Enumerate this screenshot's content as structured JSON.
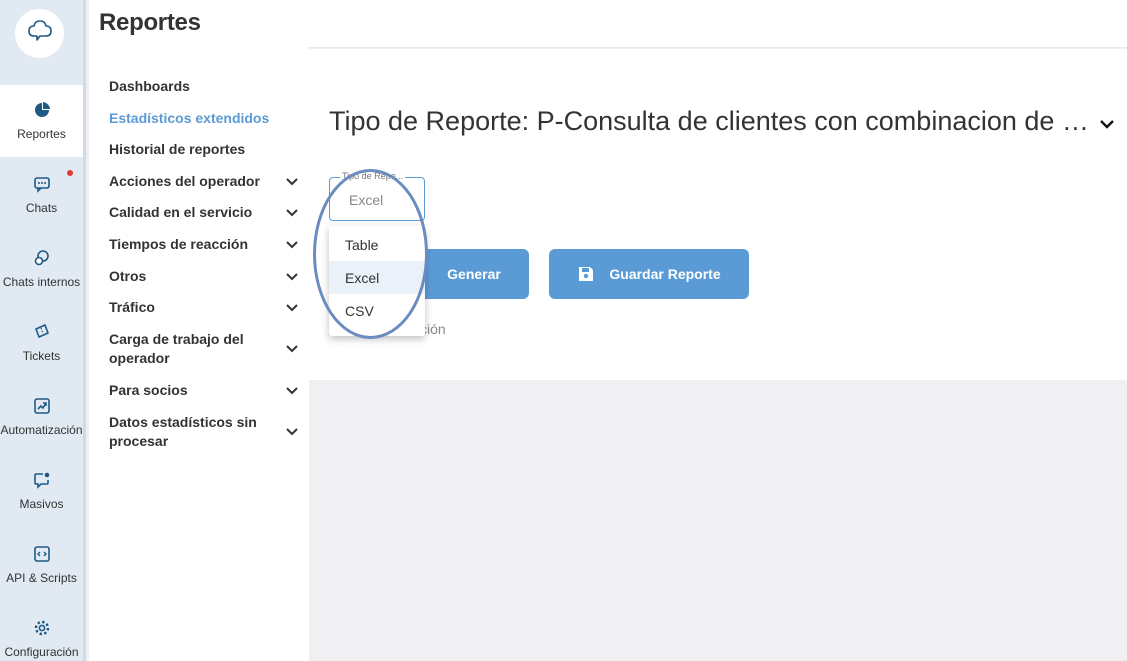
{
  "rail": {
    "items": [
      {
        "label": "Reportes",
        "icon": "pie-chart-icon"
      },
      {
        "label": "Chats",
        "icon": "chat-icon"
      },
      {
        "label": "Chats internos",
        "icon": "internal-chat-icon"
      },
      {
        "label": "Tickets",
        "icon": "ticket-icon"
      },
      {
        "label": "Automatización",
        "icon": "trend-icon"
      },
      {
        "label": "Masivos",
        "icon": "broadcast-icon"
      },
      {
        "label": "API & Scripts",
        "icon": "code-icon"
      },
      {
        "label": "Configuración",
        "icon": "gear-icon"
      }
    ],
    "accent": "#1f5a85"
  },
  "sidebar": {
    "title": "Reportes",
    "items": [
      {
        "label": "Dashboards"
      },
      {
        "label": "Estadísticos extendidos"
      },
      {
        "label": "Historial de reportes"
      },
      {
        "label": "Acciones del operador"
      },
      {
        "label": "Calidad en el servicio"
      },
      {
        "label": "Tiempos de reacción"
      },
      {
        "label": "Otros"
      },
      {
        "label": "Tráfico"
      },
      {
        "label": "Carga de trabajo del operador"
      },
      {
        "label": "Para socios"
      },
      {
        "label": "Datos estadísticos sin procesar"
      }
    ]
  },
  "main": {
    "report_title": "Tipo de Reporte: P-Consulta de clientes con combinacion de etiquetas",
    "select": {
      "label": "Tipo de Repo...",
      "value": "Excel"
    },
    "generate_label": "Generar",
    "save_label": "Guardar Reporte",
    "description_fragment": "ción"
  },
  "dropdown": {
    "options": [
      "Table",
      "Excel",
      "CSV"
    ],
    "selected": "Excel"
  },
  "colors": {
    "primary": "#5b9bd5",
    "active_text": "#5b9bd5"
  }
}
